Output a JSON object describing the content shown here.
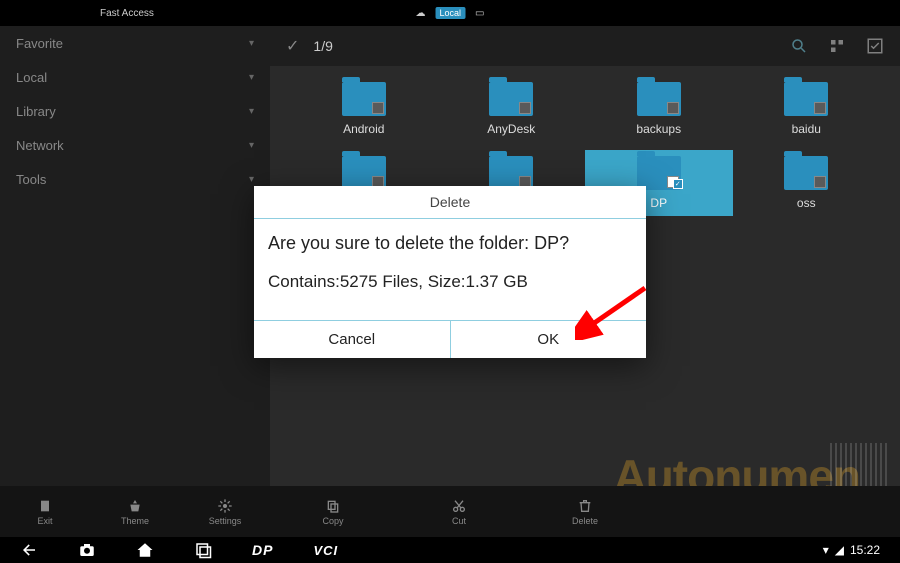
{
  "statusbar": {
    "fast_access": "Fast Access",
    "location": "Local"
  },
  "sidebar": {
    "items": [
      {
        "label": "Favorite"
      },
      {
        "label": "Local"
      },
      {
        "label": "Library"
      },
      {
        "label": "Network"
      },
      {
        "label": "Tools"
      }
    ]
  },
  "topbar": {
    "counter": "1/9"
  },
  "folders": [
    {
      "name": "Android"
    },
    {
      "name": "AnyDesk"
    },
    {
      "name": "backups"
    },
    {
      "name": "baidu"
    },
    {
      "name": ""
    },
    {
      "name": ""
    },
    {
      "name": "DP",
      "selected": true
    },
    {
      "name": "oss"
    }
  ],
  "toolbar": {
    "exit": "Exit",
    "theme": "Theme",
    "settings": "Settings",
    "copy": "Copy",
    "cut": "Cut",
    "delete": "Delete"
  },
  "navbar": {
    "dp": "DP",
    "vci": "VCI",
    "time": "15:22"
  },
  "dialog": {
    "title": "Delete",
    "question": "Are you sure to delete the folder: DP?",
    "info": "Contains:5275 Files, Size:1.37 GB",
    "cancel": "Cancel",
    "ok": "OK"
  },
  "watermark": "Autonumen"
}
